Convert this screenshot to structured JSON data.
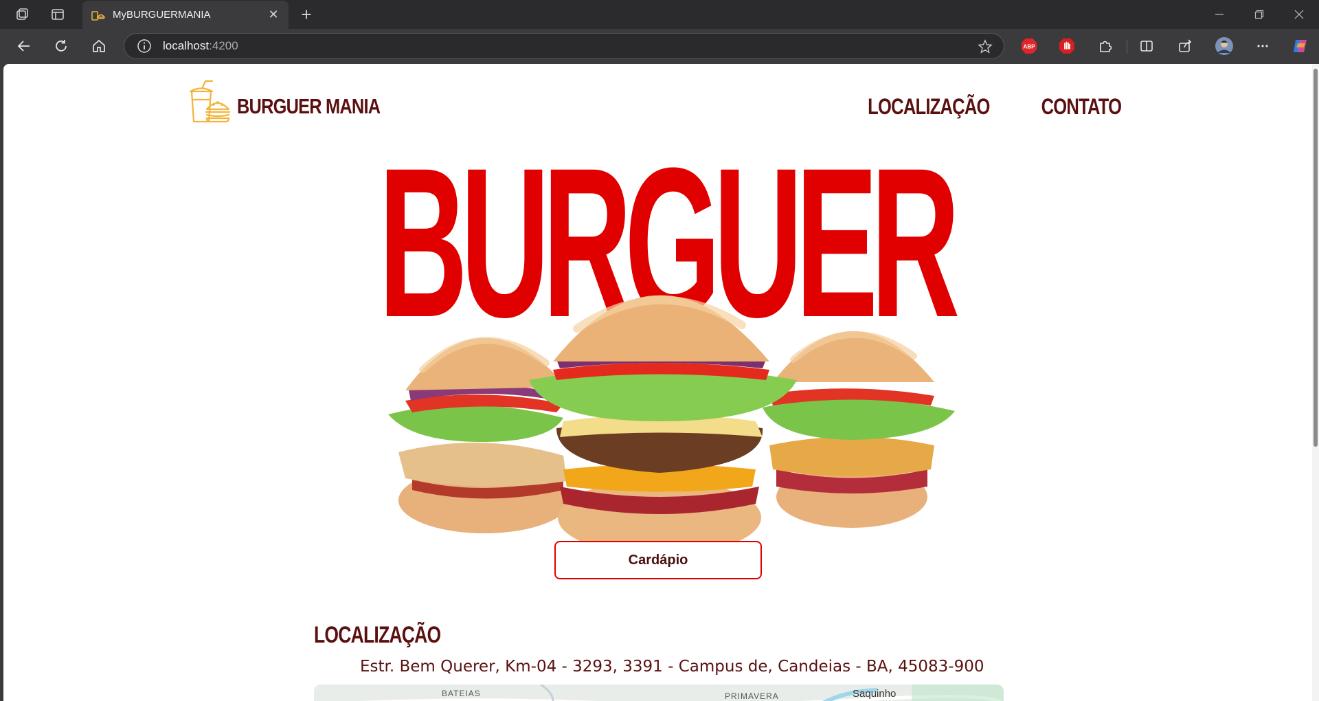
{
  "browser": {
    "tab_title": "MyBURGUERMANIA",
    "url_host": "localhost",
    "url_port": ":4200"
  },
  "site": {
    "brand_name": "BURGUER MANIA",
    "nav": [
      "LOCALIZAÇÃO",
      "CONTATO"
    ],
    "hero_word": "BURGUER",
    "cta_label": "Cardápio",
    "location_title": "LOCALIZAÇÃO",
    "address": "Estr. Bem Querer, Km-04 - 3293, 3391 - Campus de, Candeias - BA, 45083-900",
    "map_labels": [
      "BATEIAS",
      "PRIMAVERA",
      "Saquinho"
    ]
  },
  "colors": {
    "brand_dark_red": "#5a1010",
    "hero_red": "#e00000",
    "logo_yellow": "#f2b43b"
  }
}
